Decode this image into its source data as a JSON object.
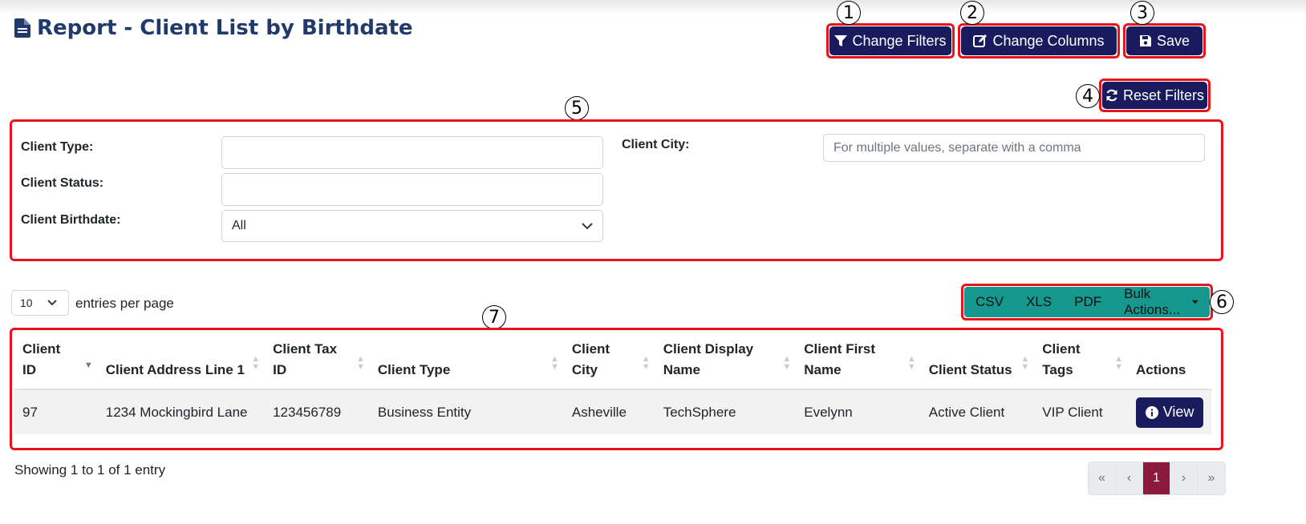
{
  "page": {
    "title": "Report - Client List by Birthdate"
  },
  "toolbar": {
    "change_filters": "Change Filters",
    "change_columns": "Change Columns",
    "save": "Save",
    "reset_filters": "Reset Filters"
  },
  "annotations": [
    "1",
    "2",
    "3",
    "4",
    "5",
    "6",
    "7"
  ],
  "filters": {
    "client_type_label": "Client Type:",
    "client_type_value": "",
    "client_status_label": "Client Status:",
    "client_status_value": "",
    "client_birthdate_label": "Client Birthdate:",
    "client_birthdate_value": "All",
    "client_city_label": "Client City:",
    "client_city_placeholder": "For multiple values, separate with a comma"
  },
  "entries": {
    "value": "10",
    "label": "entries per page"
  },
  "export": {
    "csv": "CSV",
    "xls": "XLS",
    "pdf": "PDF",
    "bulk": "Bulk Actions..."
  },
  "table": {
    "headers": {
      "client_id_1": "Client",
      "client_id_2": "ID",
      "address": "Client Address Line 1",
      "tax_1": "Client Tax",
      "tax_2": "ID",
      "type": "Client Type",
      "city_1": "Client",
      "city_2": "City",
      "display_1": "Client Display",
      "display_2": "Name",
      "first_1": "Client First",
      "first_2": "Name",
      "status": "Client Status",
      "tags_1": "Client",
      "tags_2": "Tags",
      "actions": "Actions"
    },
    "rows": [
      {
        "id": "97",
        "address": "1234 Mockingbird Lane",
        "tax_id": "123456789",
        "type": "Business Entity",
        "city": "Asheville",
        "display_name": "TechSphere",
        "first_name": "Evelynn",
        "status": "Active Client",
        "tags": "VIP Client",
        "action": "View"
      }
    ]
  },
  "footer": {
    "showing": "Showing 1 to 1 of 1 entry"
  },
  "pagination": {
    "first": "«",
    "prev": "‹",
    "current": "1",
    "next": "›",
    "last": "»"
  },
  "colors": {
    "primary": "#1a1a5e",
    "title": "#1f3a6b",
    "export": "#17988f",
    "annotation": "#e8141b",
    "page_active": "#8b1a3c"
  }
}
